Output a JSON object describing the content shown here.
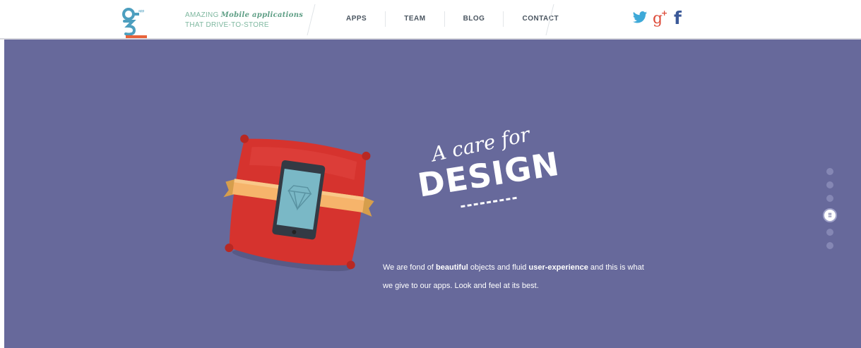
{
  "header": {
    "logo_icon": "q3-logo",
    "tagline_line1_prefix": "AMAZING ",
    "tagline_line1_script": "Mobile applications",
    "tagline_line2": "THAT DRIVE-TO-STORE",
    "nav": [
      {
        "label": "APPS"
      },
      {
        "label": "TEAM"
      },
      {
        "label": "BLOG"
      },
      {
        "label": "CONTACT"
      }
    ],
    "social": [
      {
        "name": "twitter-icon"
      },
      {
        "name": "google-plus-icon"
      },
      {
        "name": "facebook-icon"
      }
    ]
  },
  "hero": {
    "headline_script": "A care for",
    "headline_big": "DESIGN",
    "desc_parts": [
      "We are fond of ",
      "beautiful",
      " objects and fluid ",
      "user-experience",
      " and this is what we give to our apps. Look and feel at its best."
    ],
    "illustration": "phone-on-red-cushion",
    "pager": {
      "count": 6,
      "active_index": 3,
      "active_icon": "grid-icon"
    }
  },
  "colors": {
    "hero_bg": "#67699b",
    "accent": "#e8633a",
    "brand_green": "#5f9f86",
    "twitter": "#3ea9d8",
    "google_plus": "#dd4b39",
    "facebook": "#3b5998"
  }
}
